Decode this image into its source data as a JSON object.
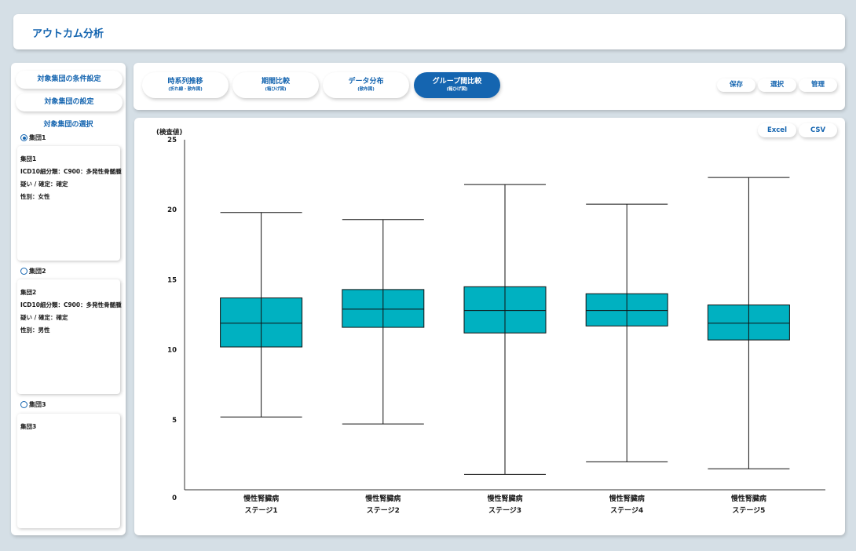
{
  "header": {
    "title": "アウトカム分析"
  },
  "sidebar": {
    "condition_button": "対象集団の条件設定",
    "settings_button": "対象集団の設定",
    "selection_heading": "対象集団の選択",
    "groups": [
      {
        "radio_label": "集団1",
        "selected": true,
        "lines": [
          "集団1",
          "ICD10細分類：C900：多発性骨髄腫",
          "疑い / 確定：確定",
          "性別：女性"
        ]
      },
      {
        "radio_label": "集団2",
        "selected": false,
        "lines": [
          "集団2",
          "ICD10細分類：C900：多発性骨髄腫",
          "疑い / 確定：確定",
          "性別：男性"
        ]
      },
      {
        "radio_label": "集団3",
        "selected": false,
        "lines": [
          "集団3"
        ]
      }
    ]
  },
  "tabs": [
    {
      "label": "時系列推移",
      "sub": "(折れ線・散布図)",
      "active": false
    },
    {
      "label": "期間比較",
      "sub": "(箱ひげ図)",
      "active": false
    },
    {
      "label": "データ分布",
      "sub": "(散布図)",
      "active": false
    },
    {
      "label": "グループ間比較",
      "sub": "(箱ひげ図)",
      "active": true
    }
  ],
  "actions": {
    "save": "保存",
    "select": "選択",
    "manage": "管理"
  },
  "export": {
    "excel": "Excel",
    "csv": "CSV"
  },
  "colors": {
    "accent": "#1565b0",
    "box_fill": "#00b1c1",
    "background": "#d5dfe6"
  },
  "chart_data": {
    "type": "box",
    "ylabel": "(検査値)",
    "ylim": [
      0,
      25
    ],
    "yticks": [
      0,
      5,
      10,
      15,
      20,
      25
    ],
    "categories": [
      [
        "慢性腎臓病",
        "ステージ1"
      ],
      [
        "慢性腎臓病",
        "ステージ2"
      ],
      [
        "慢性腎臓病",
        "ステージ3"
      ],
      [
        "慢性腎臓病",
        "ステージ4"
      ],
      [
        "慢性腎臓病",
        "ステージ5"
      ]
    ],
    "boxes": [
      {
        "min": 5.2,
        "q1": 10.2,
        "median": 11.9,
        "q3": 13.7,
        "max": 19.8
      },
      {
        "min": 4.7,
        "q1": 11.6,
        "median": 12.9,
        "q3": 14.3,
        "max": 19.3
      },
      {
        "min": 1.1,
        "q1": 11.2,
        "median": 12.8,
        "q3": 14.5,
        "max": 21.8
      },
      {
        "min": 2.0,
        "q1": 11.7,
        "median": 12.8,
        "q3": 14.0,
        "max": 20.4
      },
      {
        "min": 1.5,
        "q1": 10.7,
        "median": 11.9,
        "q3": 13.2,
        "max": 22.3
      }
    ]
  }
}
